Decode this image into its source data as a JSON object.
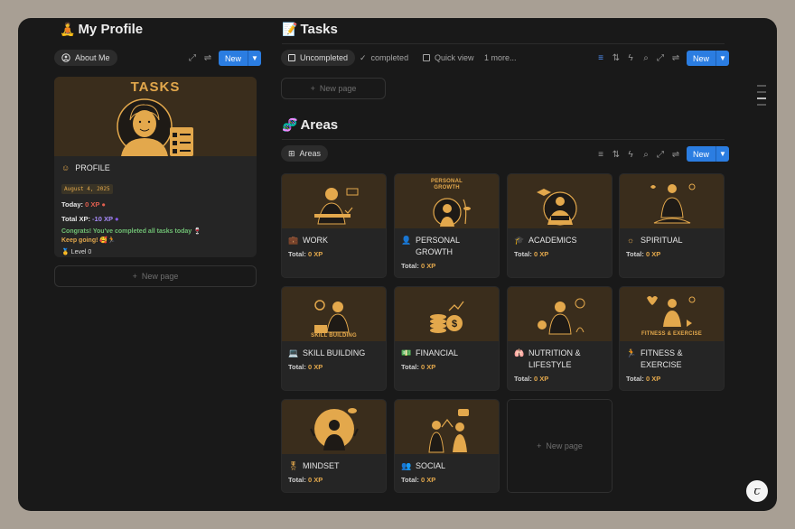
{
  "profile": {
    "title": "My Profile",
    "title_emoji": "🧘",
    "view_tab": "About Me",
    "new_label": "New",
    "cover_title": "TASKS",
    "card_title": "PROFILE",
    "date": "August 4, 2025",
    "today_label": "Today:",
    "today_value": "0 XP",
    "total_label": "Total XP:",
    "total_value": "-10 XP",
    "congrats": "Congrats! You've completed all tasks today 🍷",
    "keep_going": "Keep going! 🥰🏃",
    "level": "Level 0",
    "new_page": "New page"
  },
  "tasks": {
    "title": "Tasks",
    "title_emoji": "📝",
    "views": [
      "Uncompleted",
      "completed",
      "Quick view",
      "1 more..."
    ],
    "new_label": "New",
    "new_page": "New page"
  },
  "areas": {
    "title": "Areas",
    "title_emoji": "🧬",
    "view_tab": "Areas",
    "new_label": "New",
    "new_page": "New page",
    "total_label": "Total:",
    "cards": [
      {
        "name": "WORK",
        "xp": "0 XP",
        "icon": "briefcase-icon",
        "caption": ""
      },
      {
        "name": "PERSONAL GROWTH",
        "xp": "0 XP",
        "icon": "person-icon",
        "caption": "PERSONAL GROWTH"
      },
      {
        "name": "ACADEMICS",
        "xp": "0 XP",
        "icon": "graduation-cap-icon",
        "caption": ""
      },
      {
        "name": "SPIRITUAL",
        "xp": "0 XP",
        "icon": "sun-icon",
        "caption": ""
      },
      {
        "name": "SKILL BUILDING",
        "xp": "0 XP",
        "icon": "laptop-icon",
        "caption": "SKILL BUILDING"
      },
      {
        "name": "FINANCIAL",
        "xp": "0 XP",
        "icon": "money-icon",
        "caption": ""
      },
      {
        "name": "NUTRITION & LIFESTYLE",
        "xp": "0 XP",
        "icon": "lungs-icon",
        "caption": ""
      },
      {
        "name": "FITNESS & EXERCISE",
        "xp": "0 XP",
        "icon": "runner-icon",
        "caption": "FITNESS & EXERCISE"
      },
      {
        "name": "MINDSET",
        "xp": "0 XP",
        "icon": "medal-icon",
        "caption": ""
      },
      {
        "name": "SOCIAL",
        "xp": "0 XP",
        "icon": "people-icon",
        "caption": ""
      }
    ]
  },
  "colors": {
    "accent": "#e3a84c",
    "blue": "#2b7de1",
    "bg": "#191919",
    "card": "#252525",
    "red_xp": "#e15f4f",
    "purple_xp": "#a78bfa",
    "green_text": "#6fbf73"
  }
}
